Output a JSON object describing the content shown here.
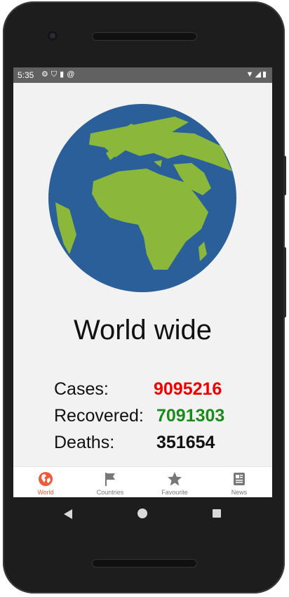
{
  "status_bar": {
    "time": "5:35",
    "left_icons": [
      "gear-icon",
      "shield-icon",
      "sd-card-icon",
      "at-icon"
    ],
    "right_icons": [
      "wifi-icon",
      "signal-icon",
      "battery-icon"
    ]
  },
  "main": {
    "title": "World wide",
    "stats": [
      {
        "label": "Cases:",
        "value": "9095216",
        "color": "#ee0000"
      },
      {
        "label": "Recovered:",
        "value": "7091303",
        "color": "#1a8a1a"
      },
      {
        "label": "Deaths:",
        "value": "351654",
        "color": "#111111"
      }
    ]
  },
  "bottom_nav": {
    "items": [
      {
        "label": "World",
        "icon": "globe-icon",
        "active": true
      },
      {
        "label": "Countries",
        "icon": "flag-icon",
        "active": false
      },
      {
        "label": "Favourite",
        "icon": "star-icon",
        "active": false
      },
      {
        "label": "News",
        "icon": "newspaper-icon",
        "active": false
      }
    ]
  },
  "colors": {
    "accent": "#f05a3a",
    "globe_ocean": "#2a5f99",
    "globe_land": "#8bb83a"
  }
}
